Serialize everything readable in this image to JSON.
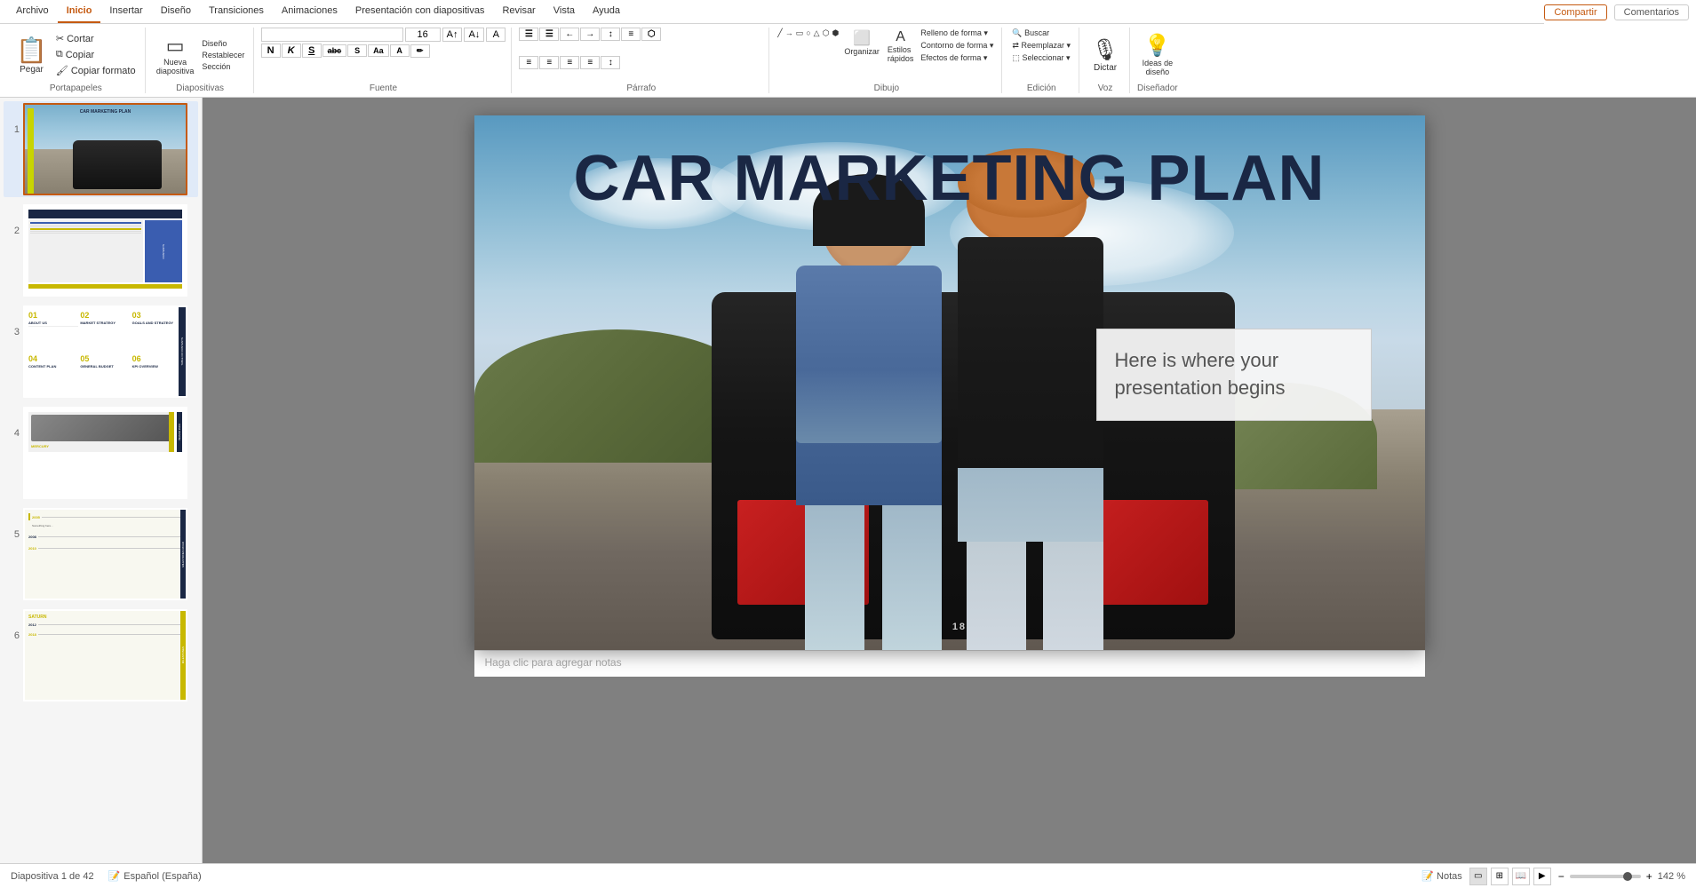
{
  "app": {
    "title": "PowerPoint"
  },
  "ribbon": {
    "tabs": [
      {
        "id": "archivo",
        "label": "Archivo"
      },
      {
        "id": "inicio",
        "label": "Inicio",
        "active": true
      },
      {
        "id": "insertar",
        "label": "Insertar"
      },
      {
        "id": "diseno",
        "label": "Diseño"
      },
      {
        "id": "transiciones",
        "label": "Transiciones"
      },
      {
        "id": "animaciones",
        "label": "Animaciones"
      },
      {
        "id": "presentacion",
        "label": "Presentación con diapositivas"
      },
      {
        "id": "revisar",
        "label": "Revisar"
      },
      {
        "id": "vista",
        "label": "Vista"
      },
      {
        "id": "ayuda",
        "label": "Ayuda"
      }
    ],
    "share_label": "Compartir",
    "comments_label": "Comentarios",
    "groups": {
      "portapapeles": {
        "label": "Portapapeles",
        "paste": "Pegar",
        "cut": "Cortar",
        "copy": "Copiar",
        "format_paint": "Copiar formato"
      },
      "diapositivas": {
        "label": "Diapositivas",
        "nueva": "Nueva\ndiapositiva",
        "diseno": "Diseño",
        "restablecer": "Restablecer",
        "seccion": "Sección"
      },
      "fuente": {
        "label": "Fuente",
        "font_name": "",
        "font_size": "16",
        "bold": "N",
        "italic": "K",
        "underline": "S",
        "strikethrough": "abc",
        "shadow": "S",
        "spacing": "Aa"
      },
      "parrafo": {
        "label": "Párrafo"
      },
      "dibujo": {
        "label": "Dibujo"
      },
      "edicion": {
        "label": "Edición",
        "buscar": "Buscar",
        "reemplazar": "Reemplazar",
        "seleccionar": "Seleccionar"
      },
      "voz": {
        "label": "Voz",
        "dictar": "Dictar"
      },
      "disenador": {
        "label": "Diseñador",
        "ideas": "Ideas de\ndiseño"
      }
    }
  },
  "slides": [
    {
      "num": 1,
      "active": true,
      "title": "CAR MARKETING PLAN"
    },
    {
      "num": 2,
      "active": false
    },
    {
      "num": 3,
      "active": false
    },
    {
      "num": 4,
      "active": false,
      "title": "MERCURY"
    },
    {
      "num": 5,
      "active": false
    },
    {
      "num": 6,
      "active": false
    }
  ],
  "main_slide": {
    "title": "CAR MARKETING PLAN",
    "textbox": "Here is where your presentation begins",
    "notes_placeholder": "Haga clic para agregar notas"
  },
  "status_bar": {
    "slide_info": "Diapositiva 1 de 42",
    "language": "Español (España)",
    "notes_label": "Notas",
    "zoom_level": "142 %"
  },
  "icons": {
    "paste": "📋",
    "cut": "✂",
    "copy": "⧉",
    "format_paint": "🖌",
    "new_slide": "▭",
    "design": "🎨",
    "reset": "↺",
    "section": "§",
    "bold": "B",
    "italic": "I",
    "underline": "U",
    "search": "🔍",
    "replace": "⇄",
    "select": "⬚",
    "dictate": "🎙",
    "ideas": "💡",
    "increase_font": "A↑",
    "decrease_font": "A↓",
    "clear_format": "A",
    "font_color": "A",
    "highlight": "✏",
    "align_left": "≡",
    "align_center": "≡",
    "align_right": "≡",
    "justify": "≡",
    "bullets": "☰",
    "numbering": "☰",
    "decrease_indent": "←",
    "increase_indent": "→",
    "text_direction": "↕",
    "align_text": "↕",
    "smartart": "⬡",
    "arrange": "⬜",
    "quick_styles": "A",
    "shape_fill": "▭",
    "shape_outline": "▭",
    "shape_effects": "⬡"
  }
}
